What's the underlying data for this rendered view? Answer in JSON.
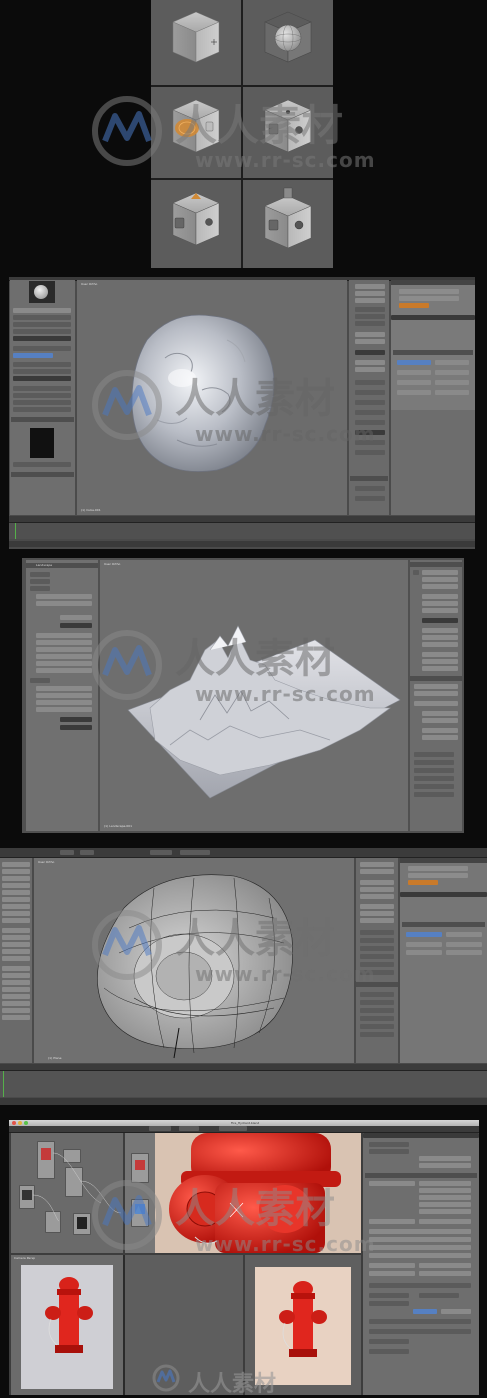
{
  "watermark": {
    "cn_text": "人人素材",
    "url_text": "www.rr-sc.com"
  },
  "panels": {
    "p2": {
      "viewport_label": "User Ortho",
      "object_label": "(1) Cube.001"
    },
    "p3": {
      "viewport_label": "User Ortho",
      "object_label": "(1) Landscape.001",
      "side_title": "Landscape"
    },
    "p4": {
      "viewport_label": "User Ortho",
      "object_label": "(1) Plane"
    },
    "p5": {
      "window_title": "Fire_Hydrant.blend",
      "bottom_left_label": "Camera Persp"
    }
  }
}
